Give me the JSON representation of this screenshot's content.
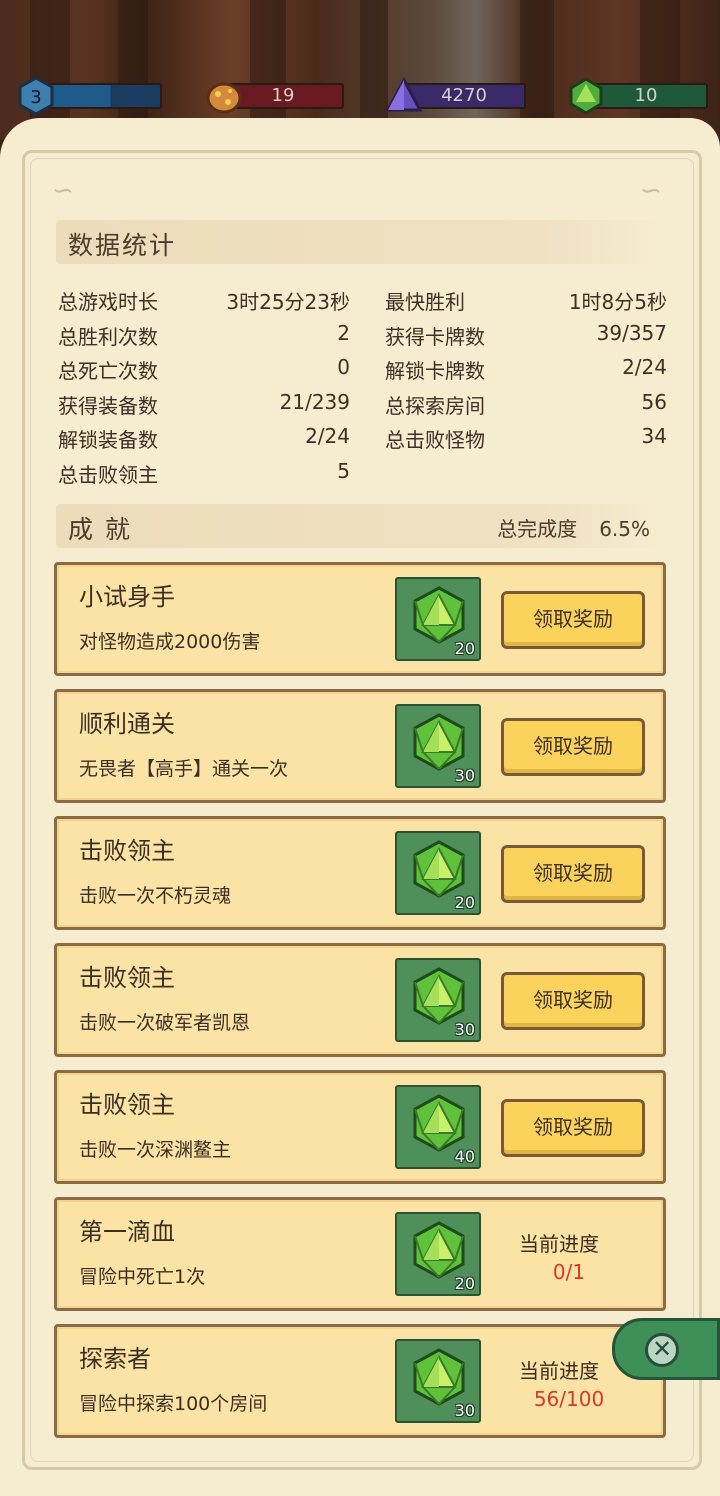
{
  "resources": {
    "level": "3",
    "gold": "19",
    "crystal": "4270",
    "gem": "10"
  },
  "stats": {
    "title": "数据统计",
    "left": [
      {
        "label": "总游戏时长",
        "value": "3时25分23秒"
      },
      {
        "label": "总胜利次数",
        "value": "2"
      },
      {
        "label": "总死亡次数",
        "value": "0"
      },
      {
        "label": "获得装备数",
        "value": "21/239"
      },
      {
        "label": "解锁装备数",
        "value": "2/24"
      },
      {
        "label": "总击败领主",
        "value": "5"
      }
    ],
    "right": [
      {
        "label": "最快胜利",
        "value": "1时8分5秒"
      },
      {
        "label": "获得卡牌数",
        "value": "39/357"
      },
      {
        "label": "解锁卡牌数",
        "value": "2/24"
      },
      {
        "label": "总探索房间",
        "value": "56"
      },
      {
        "label": "总击败怪物",
        "value": "34"
      }
    ]
  },
  "achievements": {
    "title": "成 就",
    "completion_label": "总完成度",
    "completion_value": "6.5%",
    "claim_label": "领取奖励",
    "progress_label": "当前进度",
    "items": [
      {
        "title": "小试身手",
        "desc": "对怪物造成2000伤害",
        "reward": "20"
      },
      {
        "title": "顺利通关",
        "desc": "无畏者【高手】通关一次",
        "reward": "30"
      },
      {
        "title": "击败领主",
        "desc": "击败一次不朽灵魂",
        "reward": "20"
      },
      {
        "title": "击败领主",
        "desc": "击败一次破军者凯恩",
        "reward": "30"
      },
      {
        "title": "击败领主",
        "desc": "击败一次深渊鳌主",
        "reward": "40"
      },
      {
        "title": "第一滴血",
        "desc": "冒险中死亡1次",
        "reward": "20",
        "progress": "0/1"
      },
      {
        "title": "探索者",
        "desc": "冒险中探索100个房间",
        "reward": "30",
        "progress": "56/100"
      }
    ]
  },
  "colors": {
    "parchment": "#f6ecd0",
    "card": "#fbe3a6",
    "claim_button": "#fbd35c",
    "reward_bg": "#4f8f5a",
    "progress_text": "#d83a2a"
  }
}
